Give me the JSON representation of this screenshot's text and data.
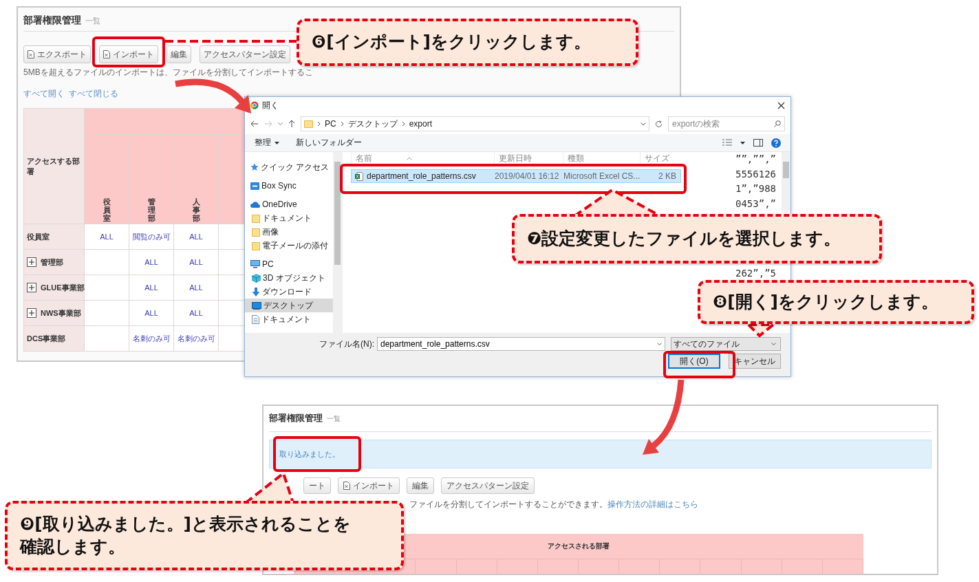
{
  "top_screen": {
    "title": "部署権限管理",
    "subtitle": "一覧",
    "buttons": [
      {
        "label": "エクスポート",
        "kind": "file"
      },
      {
        "label": "インポート",
        "kind": "file"
      },
      {
        "label": "編集",
        "kind": "plain"
      },
      {
        "label": "アクセスパターン設定",
        "kind": "plain"
      }
    ],
    "note": "5MBを超えるファイルのインポートは、ファイルを分割してインポートするこ",
    "links": [
      "すべて開く",
      "すべて閉じる"
    ],
    "table": {
      "row_header_label": "アクセスする部署",
      "columns": [
        "役員室",
        "管理部",
        "人事部"
      ],
      "rows": [
        {
          "label": "役員室",
          "kind": "single",
          "cells": [
            "ALL",
            "閲覧のみ可",
            "ALL"
          ]
        },
        {
          "label": "管理部",
          "kind": "group",
          "cells": [
            null,
            "ALL",
            "ALL"
          ]
        },
        {
          "label": "GLUE事業部",
          "kind": "group",
          "cells": [
            null,
            "ALL",
            "ALL"
          ]
        },
        {
          "label": "NWS事業部",
          "kind": "group",
          "cells": [
            null,
            "ALL",
            "ALL"
          ]
        },
        {
          "label": "DCS事業部",
          "kind": "single",
          "cells": [
            null,
            "名刺のみ可",
            "名刺のみ可"
          ]
        }
      ]
    }
  },
  "dialog": {
    "title": "開く",
    "path": [
      "PC",
      "デスクトップ",
      "export"
    ],
    "search_placeholder": "exportの検索",
    "toolbar": [
      {
        "label": "整理",
        "kind": "menu"
      },
      {
        "label": "新しいフォルダー",
        "kind": "plain"
      }
    ],
    "nav": [
      {
        "label": "クイック アクセス",
        "kind": "quick",
        "selected": false
      },
      {
        "label": "Box Sync",
        "kind": "box",
        "selected": false
      },
      {
        "label": "OneDrive",
        "kind": "cloud",
        "selected": false,
        "children": [
          {
            "label": "ドキュメント",
            "kind": "folder",
            "selected": false
          },
          {
            "label": "画像",
            "kind": "folder",
            "selected": false
          },
          {
            "label": "電子メールの添付",
            "kind": "folder",
            "selected": false
          }
        ]
      },
      {
        "label": "PC",
        "kind": "pc",
        "selected": false,
        "children": [
          {
            "label": "3D オブジェクト",
            "kind": "cube",
            "selected": false
          },
          {
            "label": "ダウンロード",
            "kind": "download",
            "selected": false
          },
          {
            "label": "デスクトップ",
            "kind": "desktop",
            "selected": true
          },
          {
            "label": "ドキュメント",
            "kind": "doc",
            "selected": false
          }
        ]
      }
    ],
    "columns": [
      "名前",
      "更新日時",
      "種類",
      "サイズ"
    ],
    "files": [
      {
        "name": "department_role_patterns.csv",
        "modified": "2019/04/01 16:12",
        "type": "Microsoft Excel CS...",
        "size": "2 KB",
        "selected": true
      }
    ],
    "preview_lines": [
      "””,””,”",
      "5556126",
      "1”,”988",
      "0453”,”",
      "262”,”5"
    ],
    "filename_label": "ファイル名(N):",
    "filename": "department_role_patterns.csv",
    "filetype": "すべてのファイル",
    "buttons": [
      {
        "label": "開く(O)",
        "kind": "primary"
      },
      {
        "label": "キャンセル",
        "kind": "secondary"
      }
    ]
  },
  "bottom_screen": {
    "title": "部署権限管理",
    "subtitle": "一覧",
    "alert": "取り込みました。",
    "buttons": [
      {
        "label": "ート",
        "kind": "plain"
      },
      {
        "label": "インポート",
        "kind": "file"
      },
      {
        "label": "編集",
        "kind": "plain"
      },
      {
        "label": "アクセスパターン設定",
        "kind": "plain"
      }
    ],
    "note": "ファイルを分割してインポートすることができます。",
    "help_link": "操作方法の詳細はこちら",
    "table_header": "アクセスされる部署"
  },
  "callouts": [
    {
      "text": "❻[インポート]をクリックします。"
    },
    {
      "text": "❼設定変更したファイルを選択します。"
    },
    {
      "text": "❽[開く]をクリックします。"
    },
    {
      "text": "❾[取り込みました。]と表示されることを確認します。"
    }
  ]
}
